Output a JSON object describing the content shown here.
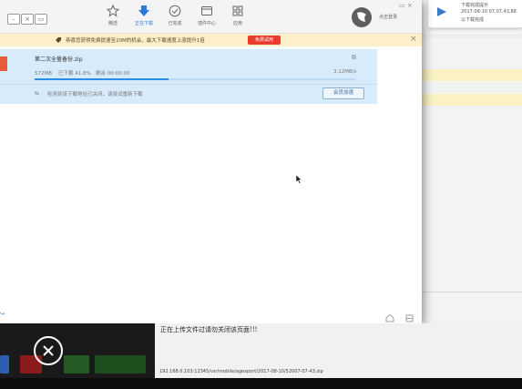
{
  "background_page": {
    "notification": {
      "line1": "下载完成提示",
      "line2": "2017-08-10 07,07,43,88",
      "line3": "以下载完成"
    }
  },
  "toolbar": {
    "tools": [
      {
        "label": "精选",
        "icon": "star-icon"
      },
      {
        "label": "正在下载",
        "icon": "download-arrow-icon"
      },
      {
        "label": "已完成",
        "icon": "check-circle-icon"
      },
      {
        "label": "插件中心",
        "icon": "plugin-icon"
      },
      {
        "label": "应用",
        "icon": "apps-grid-icon"
      }
    ],
    "user_login": "点击登录"
  },
  "banner": {
    "text": "恭喜您获得免费提速至20M的机会，最大下载速度上涨提升1倍",
    "button": "免费试用"
  },
  "task": {
    "file_name": "第二次全量备份.zip",
    "size": "572MB",
    "progress_text": "已下载 41.8%",
    "remaining": "剩余 00:00:00",
    "speed": "3.12MB/s",
    "progress": 0.418,
    "hint": "检测到该下载地址已关闭，请尝试重新下载",
    "vip_button": "会员加速"
  },
  "page": {
    "upload_text": "正在上传文件过请勿关闭该页面!!!",
    "status_url": "192.168.0.103:12345/vsr/mobile/agexport/2017-08-10/52007-07-43.zip"
  },
  "colors": {
    "accent": "#2a78d8",
    "banner_bg": "#fcefc9",
    "banner_button": "#e83d2d",
    "task_bg": "#d7ebfb"
  }
}
